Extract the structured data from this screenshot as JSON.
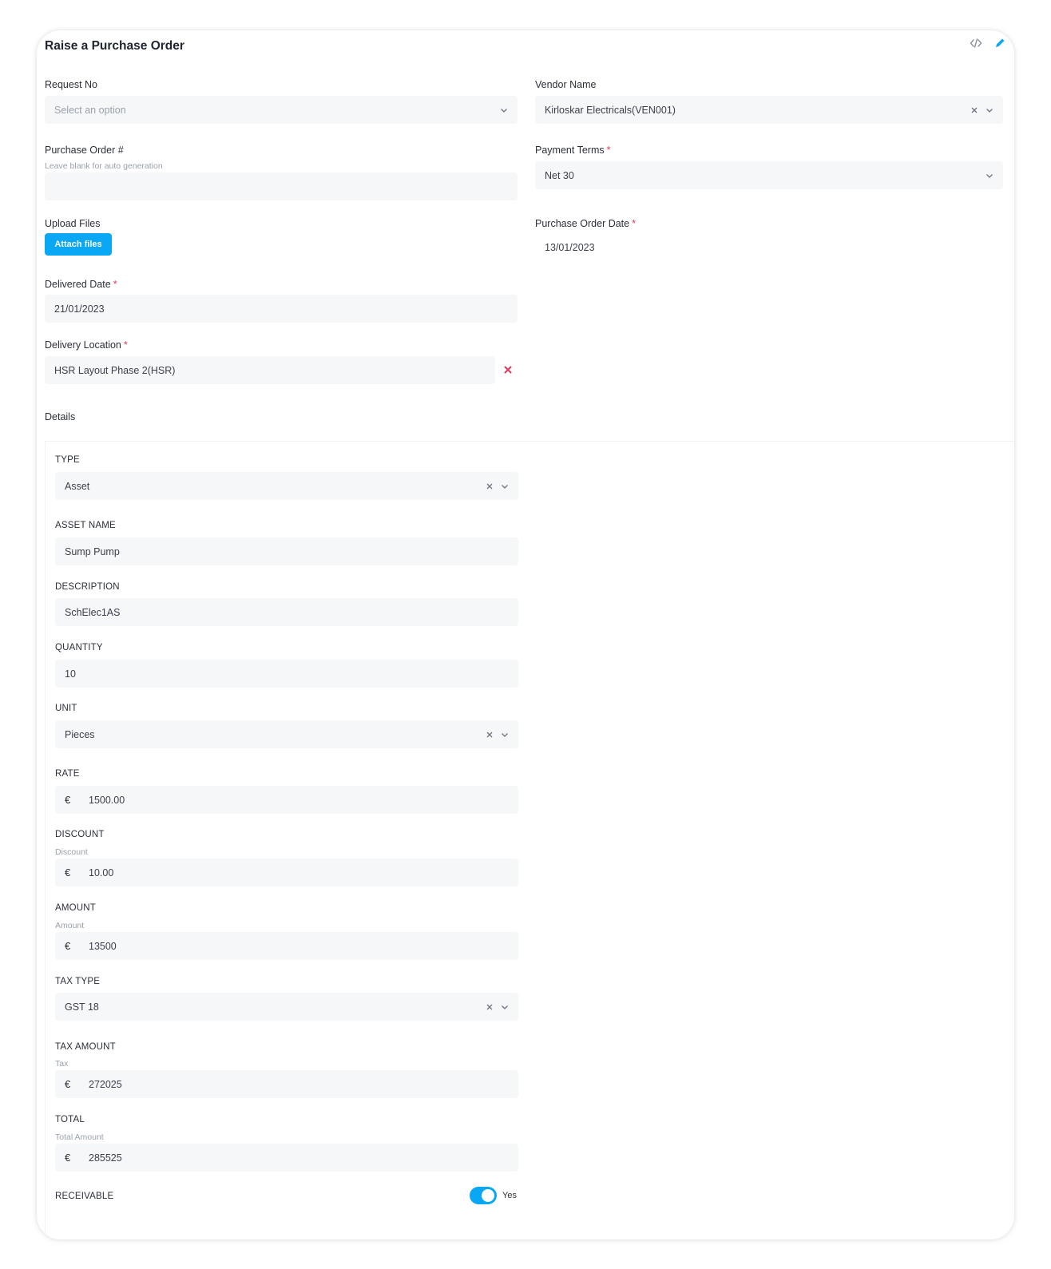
{
  "header": {
    "title": "Raise a Purchase Order",
    "icons": [
      "code-icon",
      "pencil-icon"
    ]
  },
  "form": {
    "request_no": {
      "label": "Request No",
      "placeholder": "Select an option"
    },
    "vendor_name": {
      "label": "Vendor Name",
      "value": "Kirloskar Electricals(VEN001)"
    },
    "purchase_order_no": {
      "label": "Purchase Order #",
      "hint": "Leave blank for auto generation",
      "value": ""
    },
    "payment_terms": {
      "label": "Payment Terms",
      "required": "*",
      "value": "Net 30"
    },
    "upload_files": {
      "label": "Upload Files",
      "button": "Attach files"
    },
    "purchase_order_date": {
      "label": "Purchase Order Date",
      "required": "*",
      "value": "13/01/2023"
    },
    "delivered_date": {
      "label": "Delivered Date",
      "required": "*",
      "value": "21/01/2023"
    },
    "delivery_location": {
      "label": "Delivery Location",
      "required": "*",
      "value": "HSR Layout Phase 2(HSR)"
    }
  },
  "details": {
    "title": "Details",
    "currency_symbol": "€",
    "type": {
      "label": "TYPE",
      "value": "Asset"
    },
    "asset_name": {
      "label": "ASSET NAME",
      "value": "Sump Pump"
    },
    "description": {
      "label": "DESCRIPTION",
      "value": "SchElec1AS"
    },
    "quantity": {
      "label": "QUANTITY",
      "value": "10"
    },
    "unit": {
      "label": "UNIT",
      "value": "Pieces"
    },
    "rate": {
      "label": "RATE",
      "value": "1500.00"
    },
    "discount": {
      "label": "DISCOUNT",
      "hint": "Discount",
      "value": "10.00"
    },
    "amount": {
      "label": "AMOUNT",
      "hint": "Amount",
      "value": "13500"
    },
    "tax_type": {
      "label": "TAX TYPE",
      "value": "GST 18"
    },
    "tax_amount": {
      "label": "TAX AMOUNT",
      "hint": "Tax",
      "value": "272025"
    },
    "total": {
      "label": "TOTAL",
      "hint": "Total Amount",
      "value": "285525"
    },
    "receivable": {
      "label": "RECEIVABLE",
      "toggle_text": "Yes",
      "on": true
    }
  },
  "colors": {
    "accent": "#0aa7f4",
    "required": "#e0385f",
    "field_bg": "#f6f7f9"
  }
}
